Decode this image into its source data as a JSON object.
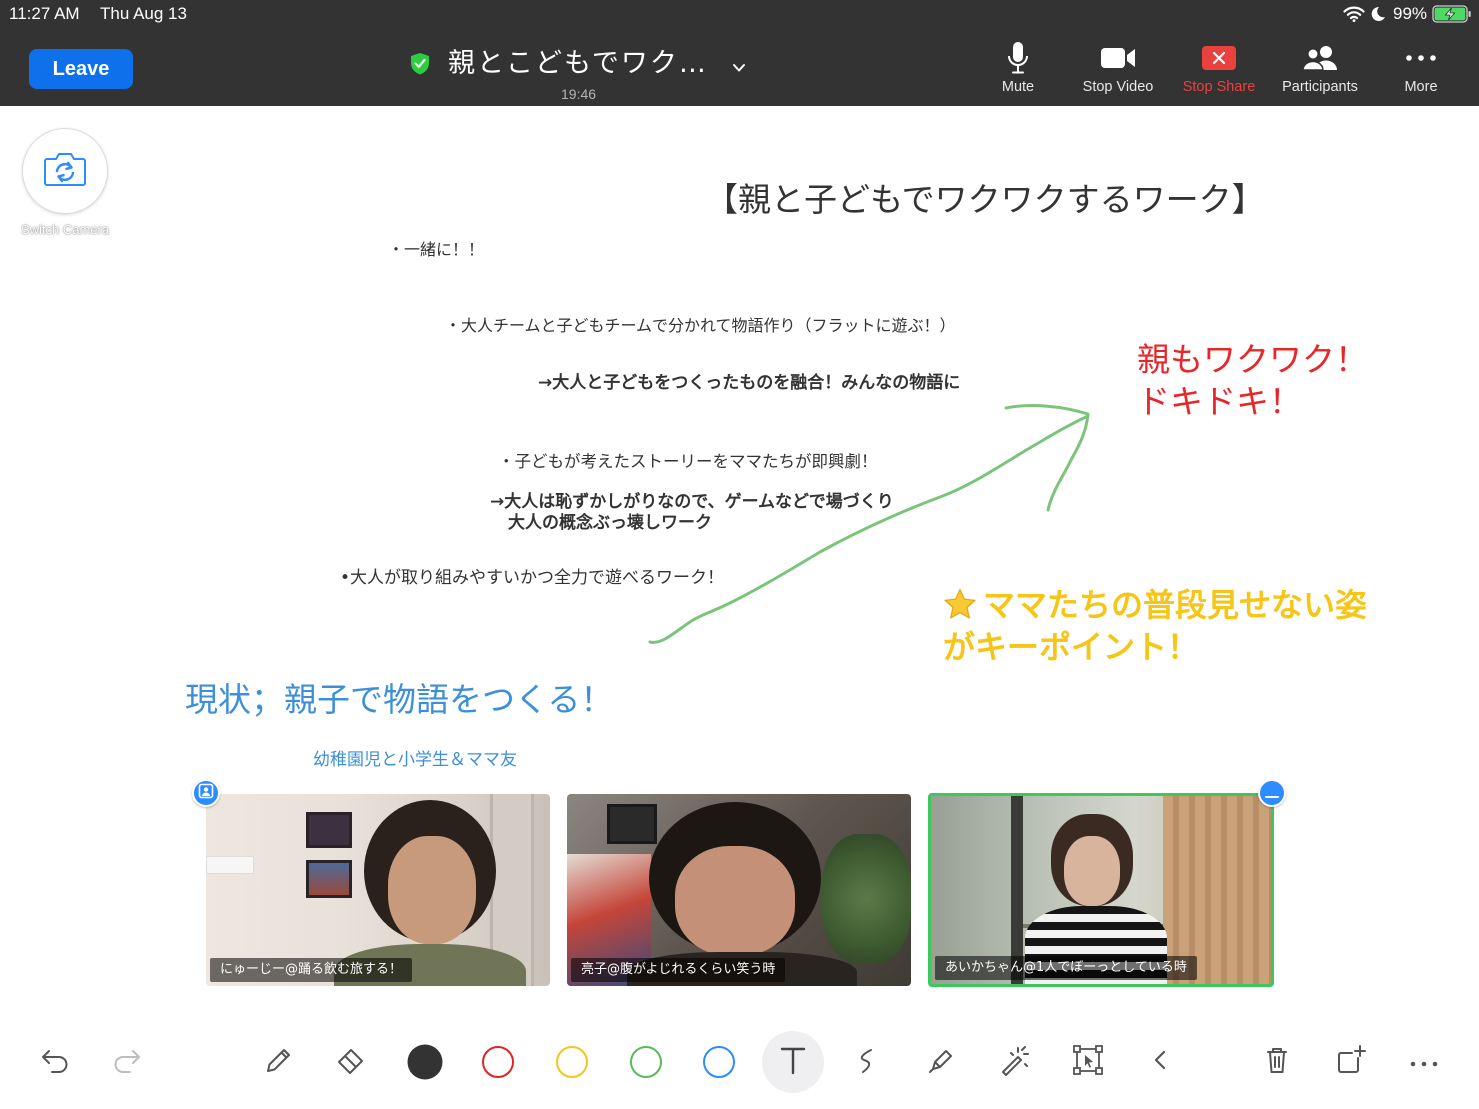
{
  "status_bar": {
    "time": "11:27 AM",
    "date": "Thu Aug 13",
    "battery": "99%",
    "battery_level": 0.99,
    "icons": [
      "wifi-icon",
      "moon-icon",
      "battery-charging-icon"
    ]
  },
  "header": {
    "leave_label": "Leave",
    "meeting_title": "親とこどもでワク…",
    "elapsed_time": "19:46",
    "controls": [
      {
        "label": "Mute",
        "icon": "microphone-icon"
      },
      {
        "label": "Stop Video",
        "icon": "video-camera-icon"
      },
      {
        "label": "Stop Share",
        "icon": "stop-share-icon"
      },
      {
        "label": "Participants",
        "icon": "participants-icon"
      },
      {
        "label": "More",
        "icon": "more-dots-icon"
      }
    ]
  },
  "switch_camera": {
    "label": "Switch Camera",
    "icon": "switch-camera-icon"
  },
  "whiteboard": {
    "title": "【親と子どもでワクワクするワーク】",
    "lines": [
      "・一緒に！！",
      "・大人チームと子どもチームで分かれて物語作り（フラットに遊ぶ！）",
      "→大人と子どもをつくったものを融合！みんなの物語に",
      "・子どもが考えたストーリーをママたちが即興劇！",
      "→大人は恥ずかしがりなので、ゲームなどで場づくり",
      "大人の概念ぶっ壊しワーク",
      "•大人が取り組みやすいかつ全力で遊べるワーク！"
    ],
    "red_note": [
      "親もワクワク！",
      "ドキドキ！"
    ],
    "yellow_note_icon": "star-icon",
    "yellow_note": [
      "ママたちの普段見せない姿",
      "がキーポイント！"
    ],
    "blue_heading": "現状；親子で物語をつくる！",
    "blue_subheading": "幼稚園児と小学生＆ママ友",
    "drawn_arrow_icon": "hand-drawn-arrow"
  },
  "participants": [
    {
      "name": "にゅーじー@踊る飲む旅する！",
      "active": false
    },
    {
      "name": "亮子@腹がよじれるくらい笑う時",
      "active": false
    },
    {
      "name": "あいかちゃん@1人でぼーっとしている時",
      "active": true
    }
  ],
  "annotation_toolbar": {
    "tools": [
      "undo-icon",
      "redo-icon",
      "pen-icon",
      "eraser-icon",
      "color-black",
      "color-red",
      "color-yellow",
      "color-green",
      "color-blue",
      "text-tool-icon",
      "scribble-icon",
      "highlighter-icon",
      "magic-wand-icon",
      "select-icon",
      "chevron-left-icon",
      "trash-icon",
      "add-page-icon",
      "more-dots-icon"
    ],
    "pen_colors": [
      "#333333",
      "#e02424",
      "#f5c518",
      "#5cb85c",
      "#2d8cff"
    ],
    "selected_tool": "text-tool-icon"
  },
  "colors": {
    "leave_button": "#0e71eb",
    "stop_share": "#e8413e",
    "shield": "#2ecc40",
    "red_note": "#e8262a",
    "yellow_note": "#f5c518",
    "blue_note": "#3d8fd9",
    "arrow": "#7cc47a",
    "active_speaker_border": "#3cc85a",
    "badge": "#2d8cff"
  }
}
